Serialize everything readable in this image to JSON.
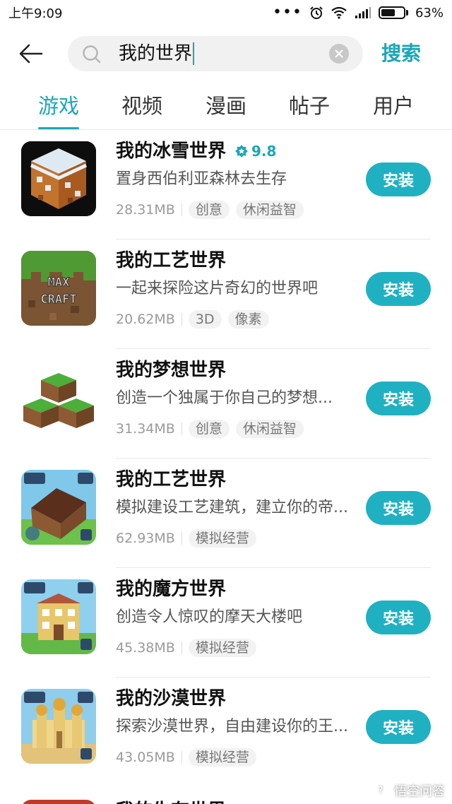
{
  "status_bar": {
    "time": "上午9:09",
    "dots": "•••",
    "battery": "63%",
    "battery_level": 0.63
  },
  "search": {
    "query": "我的世界",
    "submit_label": "搜索"
  },
  "tabs": [
    {
      "label": "游戏",
      "active": true
    },
    {
      "label": "视频",
      "active": false
    },
    {
      "label": "漫画",
      "active": false
    },
    {
      "label": "帖子",
      "active": false
    },
    {
      "label": "用户",
      "active": false
    }
  ],
  "apps": [
    {
      "name": "我的冰雪世界",
      "rating": "9.8",
      "description": "置身西伯利亚森林去生存",
      "size": "28.31MB",
      "tags": [
        "创意",
        "休闲益智"
      ],
      "install_label": "安装"
    },
    {
      "name": "我的工艺世界",
      "description": "一起来探险这片奇幻的世界吧",
      "size": "20.62MB",
      "tags": [
        "3D",
        "像素"
      ],
      "icon_text": "MAX CRAFT",
      "install_label": "安装"
    },
    {
      "name": "我的梦想世界",
      "description": "创造一个独属于你自己的梦想...",
      "size": "31.34MB",
      "tags": [
        "创意",
        "休闲益智"
      ],
      "install_label": "安装"
    },
    {
      "name": "我的工艺世界",
      "description": "模拟建设工艺建筑，建立你的帝...",
      "size": "62.93MB",
      "tags": [
        "模拟经营"
      ],
      "install_label": "安装"
    },
    {
      "name": "我的魔方世界",
      "description": "创造令人惊叹的摩天大楼吧",
      "size": "45.38MB",
      "tags": [
        "模拟经营"
      ],
      "install_label": "安装"
    },
    {
      "name": "我的沙漠世界",
      "description": "探索沙漠世界，自由建设你的王...",
      "size": "43.05MB",
      "tags": [
        "模拟经营"
      ],
      "install_label": "安装"
    }
  ],
  "partial_app": {
    "name": "我的生存世界"
  },
  "watermark": {
    "text": "悟空问答"
  },
  "colors": {
    "accent": "#1aa7b8",
    "install_button": "#1fb1c2"
  }
}
